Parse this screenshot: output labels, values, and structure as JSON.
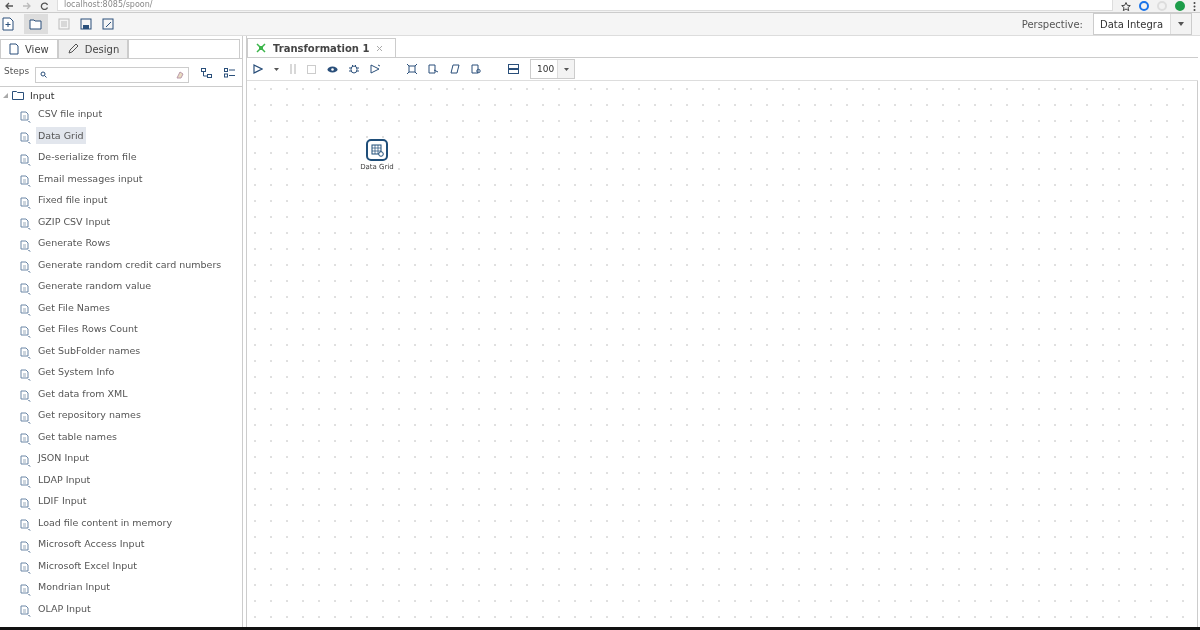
{
  "browser": {
    "address": "localhost:8085/spoon/"
  },
  "perspective": {
    "label": "Perspective:",
    "value": "Data Integra"
  },
  "left_tabs": [
    {
      "label": "View",
      "selected": false
    },
    {
      "label": "Design",
      "selected": true
    }
  ],
  "steps": {
    "label": "Steps"
  },
  "tree": [
    {
      "label": "Input",
      "expanded": true,
      "children": [
        {
          "label": "CSV file input",
          "selected": false
        },
        {
          "label": "Data Grid",
          "selected": true
        },
        {
          "label": "De-serialize from file",
          "selected": false
        },
        {
          "label": "Email messages input",
          "selected": false
        },
        {
          "label": "Fixed file input",
          "selected": false
        },
        {
          "label": "GZIP CSV Input",
          "selected": false
        },
        {
          "label": "Generate Rows",
          "selected": false
        },
        {
          "label": "Generate random credit card numbers",
          "selected": false
        },
        {
          "label": "Generate random value",
          "selected": false
        },
        {
          "label": "Get File Names",
          "selected": false
        },
        {
          "label": "Get Files Rows Count",
          "selected": false
        },
        {
          "label": "Get SubFolder names",
          "selected": false
        },
        {
          "label": "Get System Info",
          "selected": false
        },
        {
          "label": "Get data from XML",
          "selected": false
        },
        {
          "label": "Get repository names",
          "selected": false
        },
        {
          "label": "Get table names",
          "selected": false
        },
        {
          "label": "JSON Input",
          "selected": false
        },
        {
          "label": "LDAP Input",
          "selected": false
        },
        {
          "label": "LDIF Input",
          "selected": false
        },
        {
          "label": "Load file content in memory",
          "selected": false
        },
        {
          "label": "Microsoft Access Input",
          "selected": false
        },
        {
          "label": "Microsoft Excel Input",
          "selected": false
        },
        {
          "label": "Mondrian Input",
          "selected": false
        },
        {
          "label": "OLAP Input",
          "selected": false
        }
      ]
    }
  ],
  "editor_tabs": [
    {
      "label": "Transformation 1",
      "selected": true
    }
  ],
  "zoom": {
    "value": "100"
  },
  "canvas": {
    "steps": [
      {
        "label": "Data Grid"
      }
    ]
  }
}
